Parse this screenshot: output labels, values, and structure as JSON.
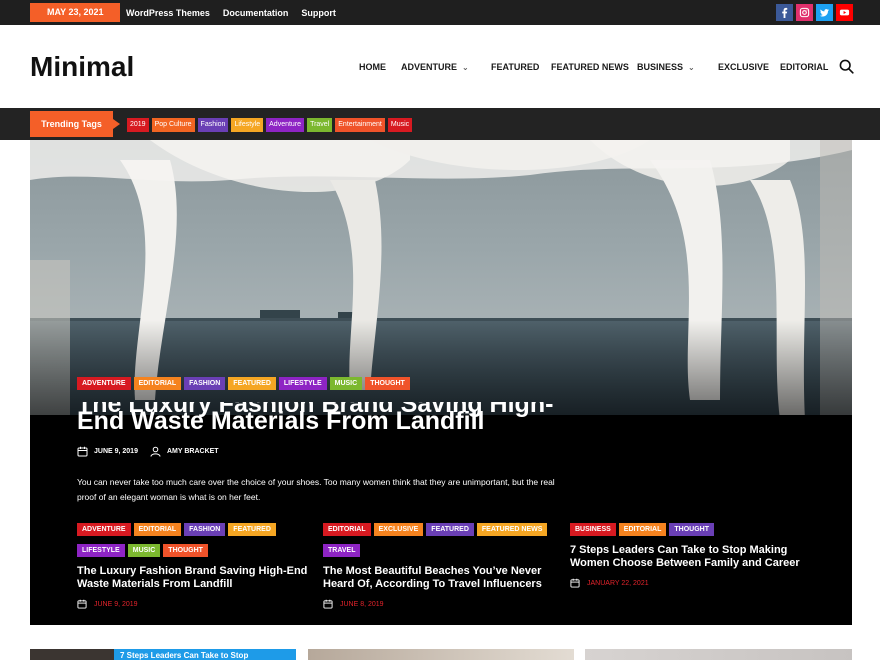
{
  "topbar": {
    "date": "MAY 23, 2021",
    "links": [
      "WordPress Themes",
      "Documentation",
      "Support"
    ],
    "social": [
      {
        "icon": "facebook-icon",
        "color": "#3b5998"
      },
      {
        "icon": "instagram-icon",
        "color": "#e1306c"
      },
      {
        "icon": "twitter-icon",
        "color": "#1da1f2"
      },
      {
        "icon": "youtube-icon",
        "color": "#ff0000"
      }
    ]
  },
  "header": {
    "logo": "Minimal",
    "nav": [
      {
        "label": "HOME",
        "dropdown": false
      },
      {
        "label": "ADVENTURE",
        "dropdown": true
      },
      {
        "label": "FEATURED",
        "dropdown": false
      },
      {
        "label": "FEATURED NEWS",
        "dropdown": false
      },
      {
        "label": "BUSINESS",
        "dropdown": true
      },
      {
        "label": "EXCLUSIVE",
        "dropdown": false
      },
      {
        "label": "EDITORIAL",
        "dropdown": false
      }
    ],
    "chevron": "⌄"
  },
  "trending": {
    "label": "Trending Tags",
    "tags": [
      {
        "label": "2019",
        "color": "#d71a21"
      },
      {
        "label": "Pop Culture",
        "color": "#f26522"
      },
      {
        "label": "Fashion",
        "color": "#6a3fb5"
      },
      {
        "label": "Lifestyle",
        "color": "#f5a623"
      },
      {
        "label": "Adventure",
        "color": "#8e24c4"
      },
      {
        "label": "Travel",
        "color": "#7cb82f"
      },
      {
        "label": "Entertainment",
        "color": "#f0532a"
      },
      {
        "label": "Music",
        "color": "#d71a21"
      }
    ]
  },
  "hero": {
    "categories": [
      {
        "label": "ADVENTURE",
        "color": "#d71a21"
      },
      {
        "label": "EDITORIAL",
        "color": "#f5831f"
      },
      {
        "label": "FASHION",
        "color": "#6a3fb5"
      },
      {
        "label": "FEATURED",
        "color": "#f5a623"
      },
      {
        "label": "LIFESTYLE",
        "color": "#8e24c4"
      },
      {
        "label": "MUSIC",
        "color": "#7cb82f"
      },
      {
        "label": "THOUGHT",
        "color": "#f0532a"
      }
    ],
    "title_line1": "The Luxury Fashion Brand Saving High-",
    "title_line2": "End Waste Materials From Landfill",
    "date": "JUNE 9, 2019",
    "author": "AMY BRACKET",
    "excerpt": "You can never take too much care over the choice of your shoes. Too many women think that they are unimportant, but the real proof of an elegant woman is what is on her feet."
  },
  "cards": [
    {
      "categories": [
        {
          "label": "ADVENTURE",
          "color": "#d71a21"
        },
        {
          "label": "EDITORIAL",
          "color": "#f5831f"
        },
        {
          "label": "FASHION",
          "color": "#6a3fb5"
        },
        {
          "label": "FEATURED",
          "color": "#f5a623"
        },
        {
          "label": "LIFESTYLE",
          "color": "#8e24c4"
        },
        {
          "label": "MUSIC",
          "color": "#7cb82f"
        },
        {
          "label": "THOUGHT",
          "color": "#f0532a"
        }
      ],
      "title": "The Luxury Fashion Brand Saving High-End Waste Materials From Landfill",
      "date": "JUNE 9, 2019"
    },
    {
      "categories": [
        {
          "label": "EDITORIAL",
          "color": "#d71a21"
        },
        {
          "label": "EXCLUSIVE",
          "color": "#f5831f"
        },
        {
          "label": "FEATURED",
          "color": "#6a3fb5"
        },
        {
          "label": "FEATURED NEWS",
          "color": "#f5a623"
        },
        {
          "label": "TRAVEL",
          "color": "#8e24c4"
        }
      ],
      "title": "The Most Beautiful Beaches You’ve Never Heard Of, According To Travel Influencers",
      "date": "JUNE 8, 2019"
    },
    {
      "categories": [
        {
          "label": "BUSINESS",
          "color": "#d71a21"
        },
        {
          "label": "EDITORIAL",
          "color": "#f5831f"
        },
        {
          "label": "THOUGHT",
          "color": "#6a3fb5"
        }
      ],
      "title": "7 Steps Leaders Can Take to Stop Making Women Choose Between Family and Career",
      "date": "JANUARY 22, 2021"
    }
  ],
  "bottom": {
    "teaser": "7 Steps Leaders Can Take to Stop"
  }
}
